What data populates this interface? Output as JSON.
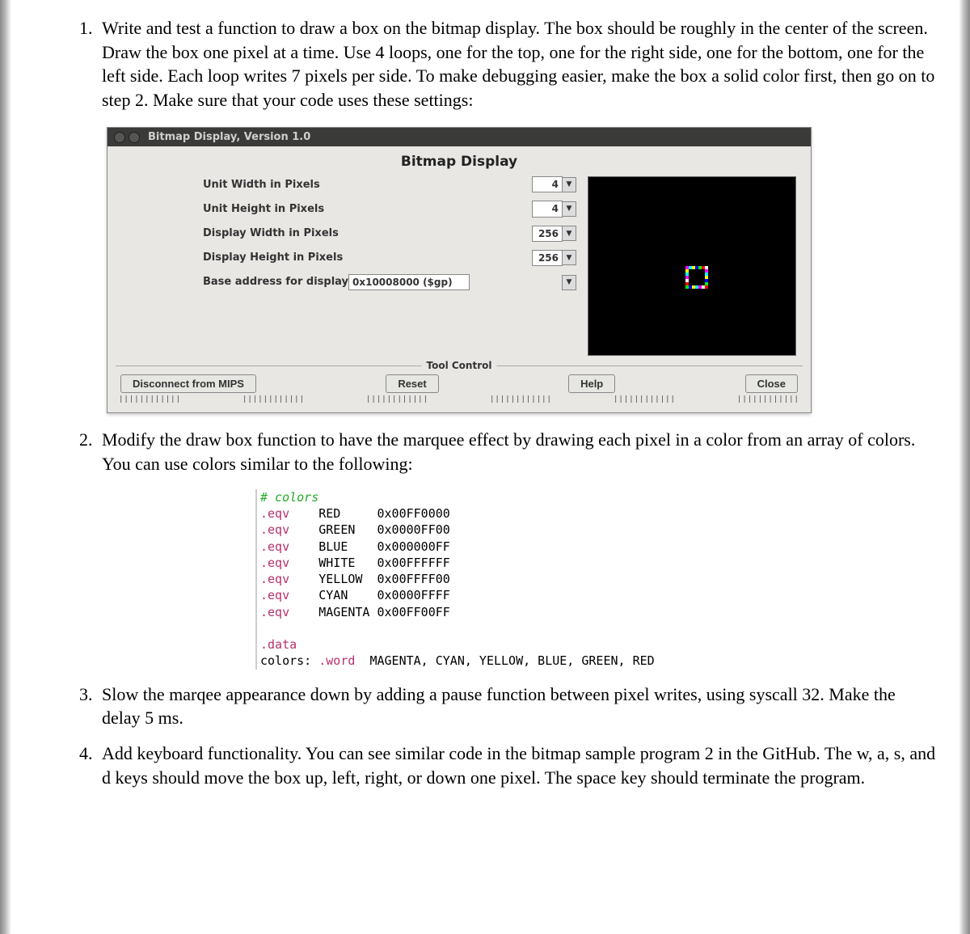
{
  "items": {
    "q1": "Write and test a function to draw a box on the bitmap display. The box should be roughly in the center of the screen. Draw the box one pixel at a time. Use 4 loops, one for the top, one for the right side, one for the bottom, one for the left side. Each loop writes 7 pixels per side. To make debugging easier, make the box a solid color first, then go on to step 2. Make sure that your code uses these settings:",
    "q2": "Modify the draw box function to have the marquee effect by drawing each pixel in a color from an array of colors. You can use colors similar to the following:",
    "q3": "Slow the marqee appearance down by adding a pause function between pixel writes, using syscall 32. Make the delay 5 ms.",
    "q4": "Add keyboard functionality. You can see similar code in the bitmap sample program 2 in the GitHub. The w, a, s, and d keys should move the box up, left, right, or down one pixel. The space key should terminate the program."
  },
  "window": {
    "titlebar": "Bitmap Display, Version 1.0",
    "heading": "Bitmap Display",
    "settings": {
      "unit_width_label": "Unit Width in Pixels",
      "unit_width_value": "4",
      "unit_height_label": "Unit Height in Pixels",
      "unit_height_value": "4",
      "display_width_label": "Display Width in Pixels",
      "display_width_value": "256",
      "display_height_label": "Display Height in Pixels",
      "display_height_value": "256",
      "base_addr_label": "Base address for display",
      "base_addr_value": "0x10008000 ($gp)"
    },
    "tool_control_label": "Tool Control",
    "buttons": {
      "disconnect": "Disconnect from MIPS",
      "reset": "Reset",
      "help": "Help",
      "close": "Close"
    }
  },
  "code": {
    "comment": "# colors",
    "l1a": ".eqv",
    "l1b": "RED",
    "l1c": "0x00FF0000",
    "l2a": ".eqv",
    "l2b": "GREEN",
    "l2c": "0x0000FF00",
    "l3a": ".eqv",
    "l3b": "BLUE",
    "l3c": "0x000000FF",
    "l4a": ".eqv",
    "l4b": "WHITE",
    "l4c": "0x00FFFFFF",
    "l5a": ".eqv",
    "l5b": "YELLOW",
    "l5c": "0x00FFFF00",
    "l6a": ".eqv",
    "l6b": "CYAN",
    "l6c": "0x0000FFFF",
    "l7a": ".eqv",
    "l7b": "MAGENTA",
    "l7c": "0x00FF00FF",
    "data_dir": ".data",
    "colors_lbl": "colors: ",
    "word_dir": ".word",
    "colors_list": "  MAGENTA, CYAN, YELLOW, BLUE, GREEN, RED"
  },
  "box_pixels": {
    "colors": [
      "#ff00ff",
      "#00ffff",
      "#ffff00",
      "#0000ff",
      "#00ff00",
      "#ff0000",
      "#ffffff"
    ],
    "ox": 120,
    "oy": 110,
    "size": 4,
    "n": 7
  }
}
